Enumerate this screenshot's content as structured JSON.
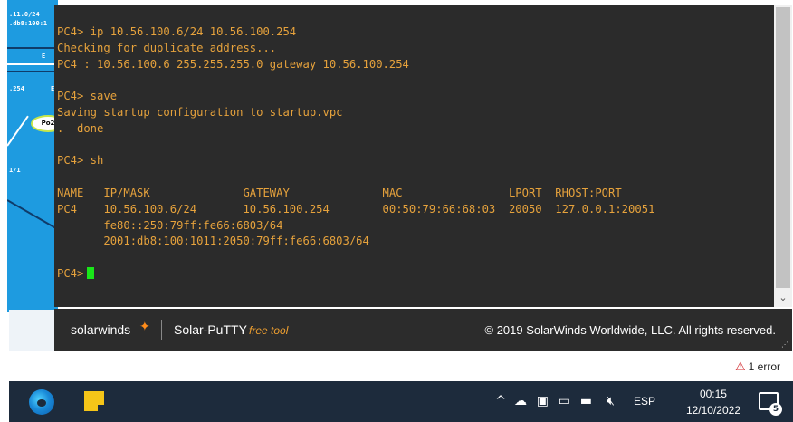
{
  "topology": {
    "labels": [
      ".11.0/24",
      ".db8:100:1",
      "E",
      ".254",
      "E",
      "1/1"
    ],
    "pill_label": "Po2"
  },
  "terminal": {
    "lines": [
      "PC4> ip 10.56.100.6/24 10.56.100.254",
      "Checking for duplicate address...",
      "PC4 : 10.56.100.6 255.255.255.0 gateway 10.56.100.254",
      "",
      "PC4> save",
      "Saving startup configuration to startup.vpc",
      ".  done",
      "",
      "PC4> sh",
      "",
      "NAME   IP/MASK              GATEWAY              MAC                LPORT  RHOST:PORT",
      "PC4    10.56.100.6/24       10.56.100.254        00:50:79:66:68:03  20050  127.0.0.1:20051",
      "       fe80::250:79ff:fe66:6803/64",
      "       2001:db8:100:1011:2050:79ff:fe66:6803/64",
      ""
    ],
    "prompt": "PC4>",
    "text_color": "#e6a23c",
    "cursor_color": "#19e619"
  },
  "brand_bar": {
    "logo_text": "solarwinds",
    "product": "Solar-PuTTY",
    "free_tool": "free tool",
    "copyright": "© 2019 SolarWinds Worldwide, LLC. All rights reserved."
  },
  "status": {
    "error_text": "1 error"
  },
  "taskbar": {
    "apps": [
      "edge-icon",
      "sticky-notes-icon"
    ],
    "tray_chevron": "^",
    "language": "ESP",
    "time": "00:15",
    "date": "12/10/2022",
    "notification_count": "5"
  }
}
